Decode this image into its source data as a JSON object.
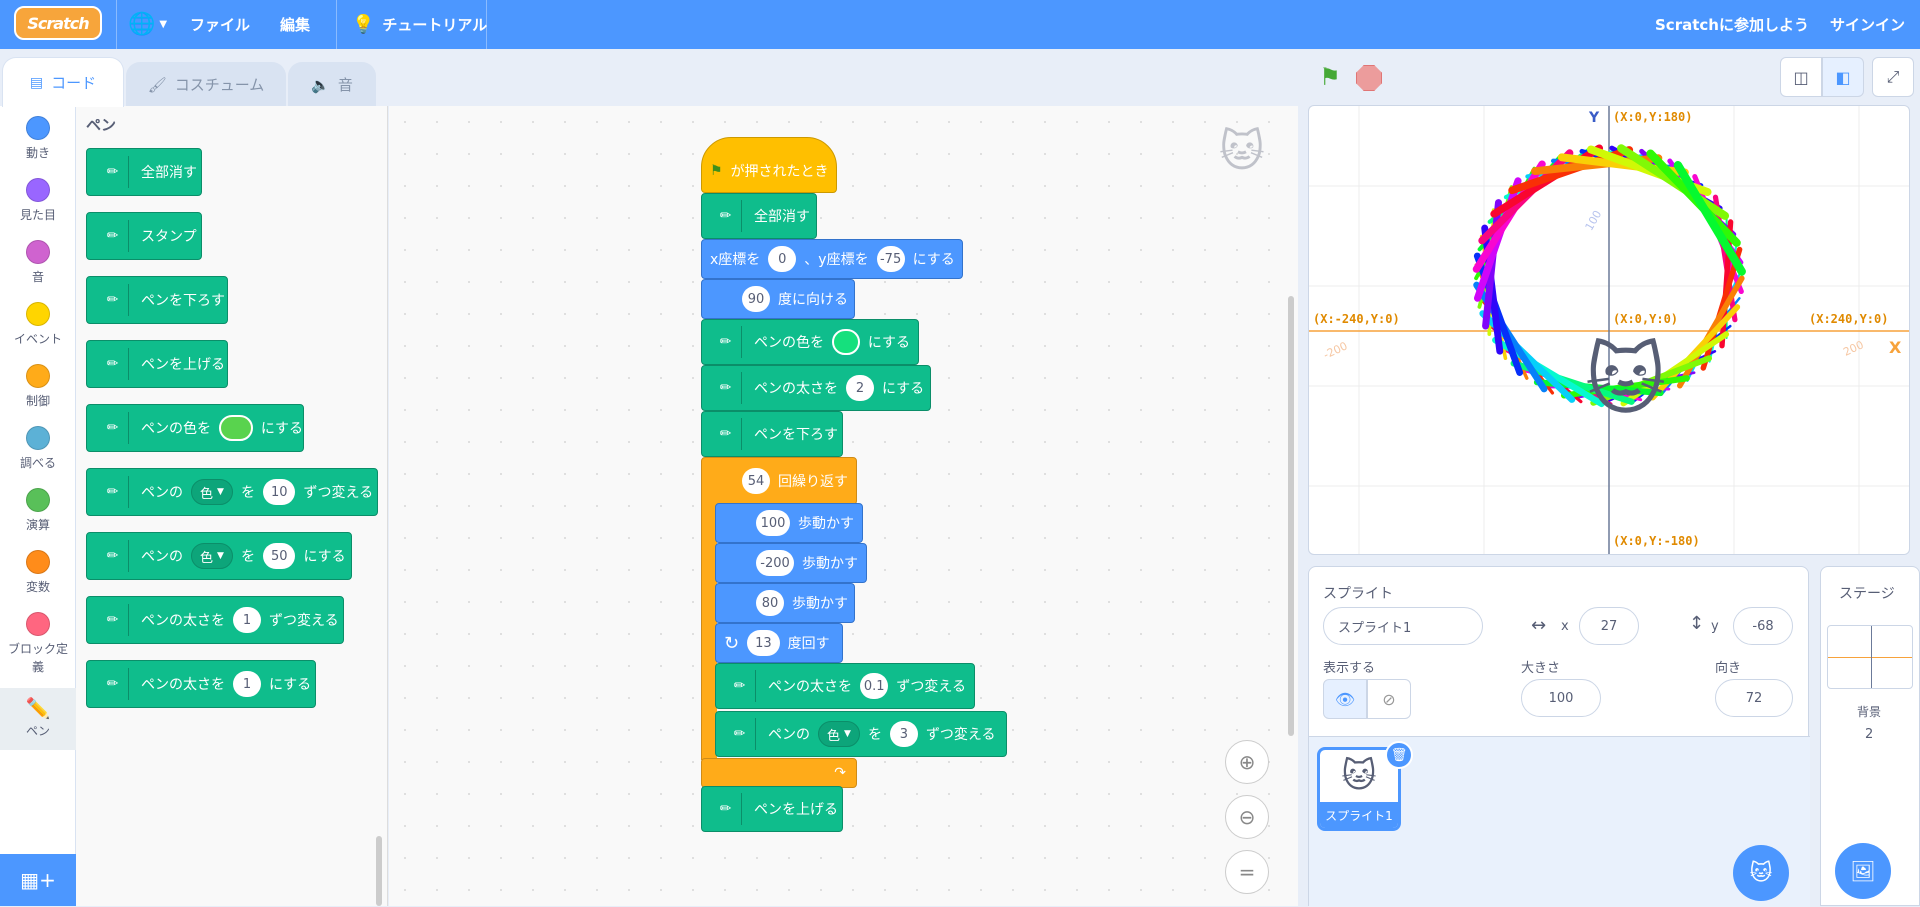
{
  "menubar": {
    "logo": "Scratch",
    "file": "ファイル",
    "edit": "編集",
    "tutorial": "チュートリアル",
    "join": "Scratchに参加しよう",
    "signin": "サインイン"
  },
  "tabs": {
    "code": "コード",
    "costume": "コスチューム",
    "sound": "音"
  },
  "categories": [
    {
      "label": "動き",
      "color": "#4c97ff"
    },
    {
      "label": "見た目",
      "color": "#9966ff"
    },
    {
      "label": "音",
      "color": "#cf63cf"
    },
    {
      "label": "イベント",
      "color": "#ffd500"
    },
    {
      "label": "制御",
      "color": "#ffab19"
    },
    {
      "label": "調べる",
      "color": "#5cb1d6"
    },
    {
      "label": "演算",
      "color": "#59c059"
    },
    {
      "label": "変数",
      "color": "#ff8c1a"
    },
    {
      "label": "ブロック定義",
      "color": "#ff6680"
    },
    {
      "label": "ペン",
      "color": "#0fbd8c"
    }
  ],
  "palette": {
    "title": "ペン",
    "clear": "全部消す",
    "stamp": "スタンプ",
    "pen_down": "ペンを下ろす",
    "pen_up": "ペンを上げる",
    "set_color_a": "ペンの色を",
    "set_color_b": "にする",
    "change_param_a": "ペンの",
    "change_param_dd": "色",
    "change_param_b": "を",
    "change_param_val": "10",
    "change_param_c": "ずつ変える",
    "set_param_a": "ペンの",
    "set_param_dd": "色",
    "set_param_b": "を",
    "set_param_val": "50",
    "set_param_c": "にする",
    "change_size_a": "ペンの太さを",
    "change_size_val": "1",
    "change_size_b": "ずつ変える",
    "set_size_a": "ペンの太さを",
    "set_size_val": "1",
    "set_size_b": "にする"
  },
  "script": {
    "hat": "が押されたとき",
    "clear": "全部消す",
    "goto_a": "x座標を",
    "goto_x": "0",
    "goto_b": "、y座標を",
    "goto_y": "-75",
    "goto_c": "にする",
    "point_val": "90",
    "point_b": "度に向ける",
    "color_a": "ペンの色を",
    "color_b": "にする",
    "size_a": "ペンの太さを",
    "size_val": "2",
    "size_b": "にする",
    "pen_down": "ペンを下ろす",
    "repeat_val": "54",
    "repeat_b": "回繰り返す",
    "move1_val": "100",
    "move2_val": "-200",
    "move3_val": "80",
    "move_b": "歩動かす",
    "turn_val": "13",
    "turn_b": "度回す",
    "chsize_a": "ペンの太さを",
    "chsize_val": "0.1",
    "chsize_b": "ずつ変える",
    "chcolor_a": "ペンの",
    "chcolor_dd": "色",
    "chcolor_b": "を",
    "chcolor_val": "3",
    "chcolor_c": "ずつ変える",
    "pen_up": "ペンを上げる"
  },
  "stage": {
    "top": "(X:0,Y:180)",
    "bottom": "(X:0,Y:-180)",
    "left": "(X:-240,Y:0)",
    "right": "(X:240,Y:0)",
    "center": "(X:0,Y:0)",
    "ylabel": "Y",
    "xlabel": "X",
    "tick_y100": "100",
    "tick_xm200": "-200",
    "tick_x200": "200"
  },
  "sprite_info": {
    "title": "スプライト",
    "name": "スプライト1",
    "x_label": "x",
    "x": "27",
    "y_label": "y",
    "y": "-68",
    "show_label": "表示する",
    "size_label": "大きさ",
    "size": "100",
    "dir_label": "向き",
    "direction": "72"
  },
  "sprite_list": {
    "thumb_label": "スプライト1"
  },
  "stage_selector": {
    "title": "ステージ",
    "backdrop_label": "背景",
    "backdrop_count": "2"
  }
}
